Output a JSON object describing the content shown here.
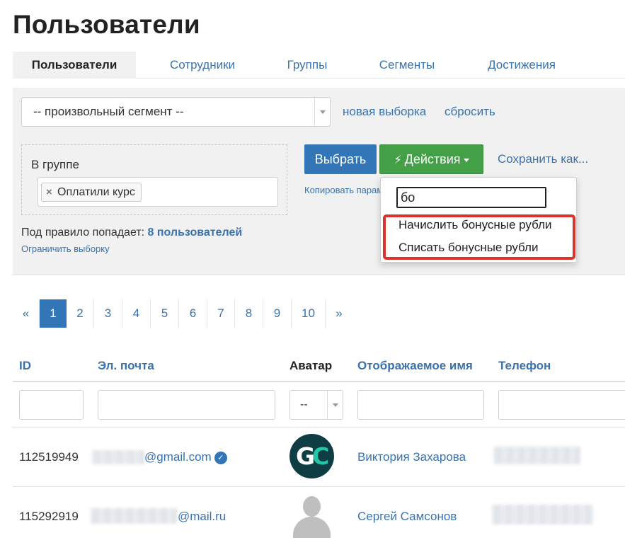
{
  "page": {
    "title": "Пользователи"
  },
  "tabs": [
    {
      "label": "Пользователи",
      "active": true
    },
    {
      "label": "Сотрудники",
      "active": false
    },
    {
      "label": "Группы",
      "active": false
    },
    {
      "label": "Сегменты",
      "active": false
    },
    {
      "label": "Достижения",
      "active": false
    }
  ],
  "filters": {
    "segment_select": {
      "value": "-- произвольный сегмент --",
      "icon": "chevron-down-icon"
    },
    "new_selection_link": "новая выборка",
    "reset_link": "сбросить",
    "group_label": "В группе",
    "group_tag": {
      "label": "Оплатили курс",
      "remove_symbol": "×"
    },
    "select_button": "Выбрать",
    "actions_button": {
      "label": "Действия",
      "icon": "lightning-bolt-icon"
    },
    "save_as_link": "Сохранить как...",
    "copy_params_link": "Копировать параметры",
    "rule_text": "Под правило попадает:",
    "rule_count": "8 пользователей",
    "limit_link": "Ограничить выборку"
  },
  "actions_dropdown": {
    "search_value": "бо",
    "items": [
      "Начислить бонусные рубли",
      "Списать бонусные рубли"
    ],
    "highlight_color": "#d9342b"
  },
  "pagination": {
    "prev": "«",
    "pages": [
      "1",
      "2",
      "3",
      "4",
      "5",
      "6",
      "7",
      "8",
      "9",
      "10"
    ],
    "current": "1",
    "next": "»"
  },
  "table": {
    "columns": [
      "ID",
      "Эл. почта",
      "Аватар",
      "Отображаемое имя",
      "Телефон"
    ],
    "avatar_filter": "--",
    "rows": [
      {
        "id": "112519949",
        "email_visible": "@gmail.com",
        "email_verified": true,
        "avatar": "GC-logo",
        "avatar_letters": [
          "G",
          "C"
        ],
        "name": "Виктория Захарова"
      },
      {
        "id": "115292919",
        "email_visible": "@mail.ru",
        "email_verified": false,
        "avatar": "default-person",
        "name": "Сергей Самсонов"
      }
    ]
  },
  "colors": {
    "primary_blue": "#3376b8",
    "link_blue": "#3a72ad",
    "actions_green": "#43a047",
    "panel_gray": "#f1f1f1",
    "logo_dark": "#0f3d44",
    "logo_teal": "#22c7a9"
  }
}
